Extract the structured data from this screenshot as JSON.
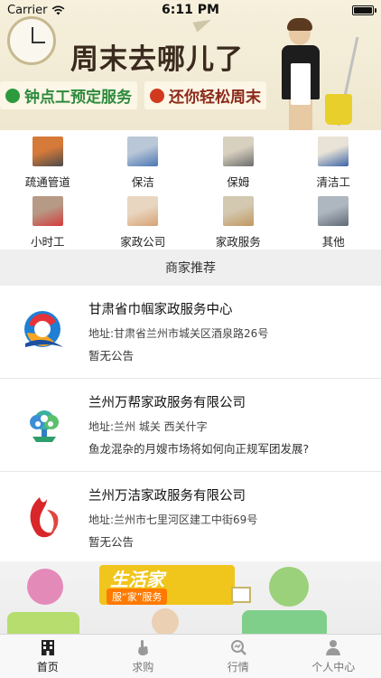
{
  "status_bar": {
    "carrier": "Carrier",
    "time": "6:11 PM",
    "battery_level": 1.0
  },
  "banner_top": {
    "headline": "周末去哪儿了",
    "pill_left": "钟点工预定服务",
    "pill_right": "还你轻松周末"
  },
  "categories": [
    {
      "label": "疏通管道",
      "icon": "pipe-worker-photo",
      "colors": [
        "#d67a3a",
        "#4b4b4b"
      ]
    },
    {
      "label": "保洁",
      "icon": "cleaner-photo",
      "colors": [
        "#b9c7d6",
        "#4a76b6"
      ]
    },
    {
      "label": "保姆",
      "icon": "nanny-photo",
      "colors": [
        "#d8d1c0",
        "#6c6c6c"
      ]
    },
    {
      "label": "清洁工",
      "icon": "janitor-photo",
      "colors": [
        "#e8e3d6",
        "#3d63a8"
      ]
    },
    {
      "label": "小时工",
      "icon": "hourly-worker-photo",
      "colors": [
        "#b69a86",
        "#d43c3c"
      ]
    },
    {
      "label": "家政公司",
      "icon": "company-photo",
      "colors": [
        "#e9d6c1",
        "#d6a274"
      ]
    },
    {
      "label": "家政服务",
      "icon": "service-photo",
      "colors": [
        "#d3c8b0",
        "#c19760"
      ]
    },
    {
      "label": "其他",
      "icon": "other-photo",
      "colors": [
        "#aeb6c0",
        "#5f6a76"
      ]
    }
  ],
  "section_header": "商家推荐",
  "merchants": [
    {
      "name": "甘肃省巾帼家政服务中心",
      "address": "地址:甘肃省兰州市城关区酒泉路26号",
      "notice": "暂无公告",
      "logo": "swirl-q-logo"
    },
    {
      "name": "兰州万帮家政服务有限公司",
      "address": "地址:兰州 城关 西关什字",
      "notice": "鱼龙混杂的月嫂市场将如何向正规军团发展?",
      "logo": "people-tree-logo"
    },
    {
      "name": "兰州万洁家政服务有限公司",
      "address": "地址:兰州市七里河区建工中街69号",
      "notice": "暂无公告",
      "logo": "red-flame-logo"
    }
  ],
  "banner_bottom": {
    "title": "生活家",
    "subtitle": "服“家”服务"
  },
  "tabbar": [
    {
      "label": "首页",
      "icon": "building-icon",
      "active": true
    },
    {
      "label": "求购",
      "icon": "hand-tap-icon",
      "active": false
    },
    {
      "label": "行情",
      "icon": "magnifier-chart-icon",
      "active": false
    },
    {
      "label": "个人中心",
      "icon": "person-icon",
      "active": false
    }
  ]
}
